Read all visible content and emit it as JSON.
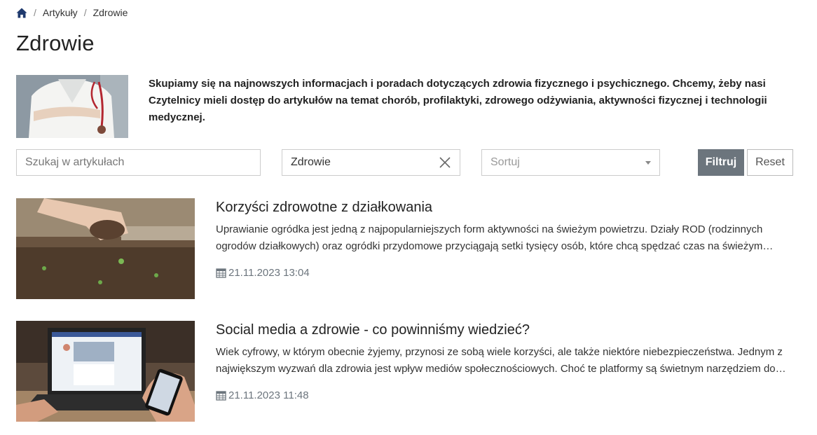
{
  "breadcrumb": {
    "items": [
      "Artykuły",
      "Zdrowie"
    ]
  },
  "page": {
    "title": "Zdrowie",
    "intro": "Skupiamy się na najnowszych informacjach i poradach dotyczących zdrowia fizycznego i psychicznego. Chcemy, żeby nasi Czytelnicy mieli dostęp do artykułów na temat chorób, profilaktyki, zdrowego odżywiania, aktywności fizycznej i technologii medycznej."
  },
  "filters": {
    "search_placeholder": "Szukaj w artykułach",
    "category_value": "Zdrowie",
    "sort_placeholder": "Sortuj",
    "filter_label": "Filtruj",
    "reset_label": "Reset"
  },
  "articles": [
    {
      "title": "Korzyści zdrowotne z działkowania",
      "excerpt": "Uprawianie ogródka jest jedną z najpopularniejszych form aktywności na świeżym powietrzu. Działy ROD (rodzinnych ogrodów działkowych) oraz ogródki przydomowe przyciągają setki tysięcy osób, które chcą spędzać czas na świeżym powietrzu.",
      "date": "21.11.2023 13:04"
    },
    {
      "title": "Social media a zdrowie - co powinniśmy wiedzieć?",
      "excerpt": "Wiek cyfrowy, w którym obecnie żyjemy, przynosi ze sobą wiele korzyści, ale także niektóre niebezpieczeństwa. Jednym z największym wyzwań dla zdrowia jest wpływ mediów społecznościowych. Choć te platformy są świetnym narzędziem do komunikacji.",
      "date": "21.11.2023 11:48"
    }
  ],
  "icons": {
    "home": "home-icon",
    "clear": "close-icon",
    "sort": "chevron-down-icon",
    "date": "calendar-icon"
  },
  "colors": {
    "brand": "#1f3a6e",
    "filter_button": "#6c757d"
  }
}
